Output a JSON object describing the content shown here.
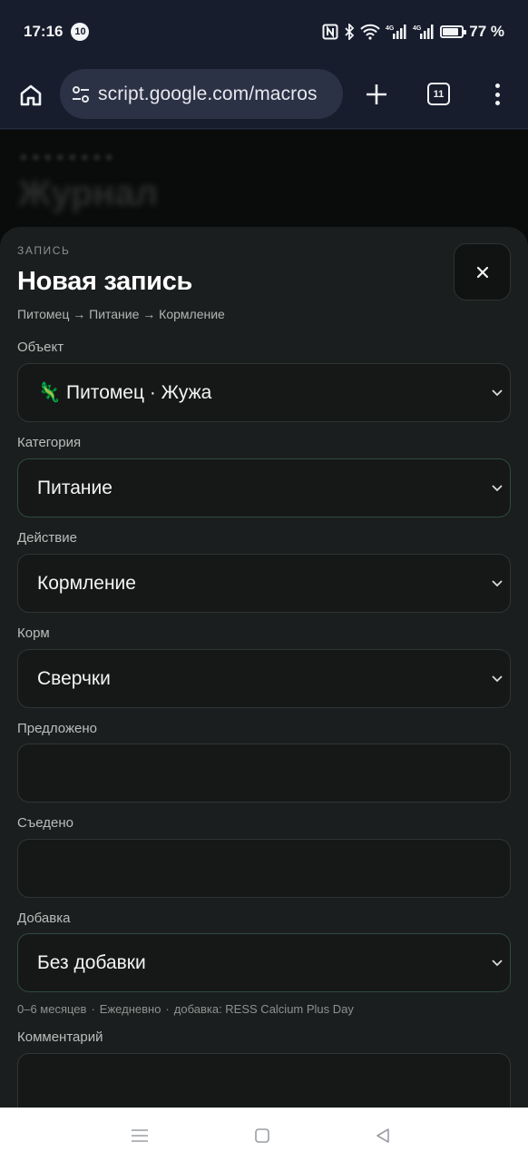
{
  "status_bar": {
    "time": "17:16",
    "notification_count": "10",
    "battery_percent": "77 %",
    "battery_level": 0.77,
    "icons": [
      "nfc-icon",
      "bluetooth-icon",
      "wifi-icon",
      "signal-4g-icon",
      "signal-4g-icon",
      "battery-icon"
    ],
    "network_labels": [
      "4G",
      "4G"
    ]
  },
  "browser": {
    "url": "script.google.com/macros",
    "tab_count": "11",
    "icons": [
      "home-icon",
      "site-settings-icon",
      "plus-icon",
      "tabs-icon",
      "more-vert-icon"
    ]
  },
  "background_page": {
    "title": "Журнал"
  },
  "sheet": {
    "kicker": "ЗАПИСЬ",
    "title": "Новая запись",
    "breadcrumb": "Питомец → Питание → Кормление",
    "close_icon": "close-icon",
    "fields": {
      "object": {
        "label": "Объект",
        "value": "🦎 Питомец · Жужа"
      },
      "category": {
        "label": "Категория",
        "value": "Питание"
      },
      "action": {
        "label": "Действие",
        "value": "Кормление"
      },
      "food": {
        "label": "Корм",
        "value": "Сверчки"
      },
      "offered": {
        "label": "Предложено",
        "value": ""
      },
      "eaten": {
        "label": "Съедено",
        "value": ""
      },
      "supplement": {
        "label": "Добавка",
        "value": "Без добавки"
      },
      "comment": {
        "label": "Комментарий",
        "value": ""
      }
    },
    "hint": {
      "age": "0–6 месяцев",
      "frequency": "Ежедневно",
      "supplement": "добавка: RESS Calcium Plus Day",
      "separator": "·"
    }
  },
  "nav_bar": {
    "icons": [
      "recents-icon",
      "home-square-icon",
      "back-icon"
    ]
  },
  "colors": {
    "status_bg": "#171d2d",
    "url_pill": "#2c3245",
    "sheet_bg": "#1b1e1e",
    "field_bg": "#161818",
    "field_border": "#2f3533",
    "accent_border": "#2e4a3e"
  }
}
